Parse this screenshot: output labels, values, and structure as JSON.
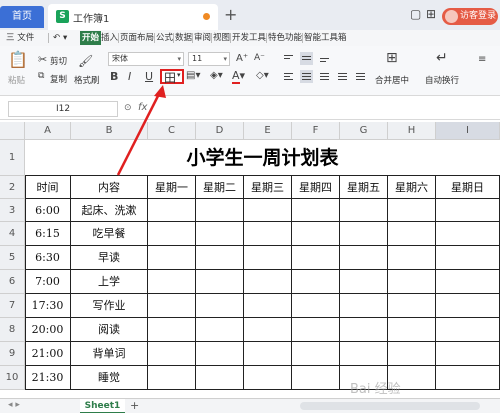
{
  "titlebar": {
    "home_tab": "首页",
    "doc_tab": "工作簿1",
    "doc_icon": "S",
    "add_tab": "+",
    "visitor_button": "访客登录"
  },
  "menu": {
    "file": "三 文件",
    "items": [
      "开始",
      "插入",
      "页面布局",
      "公式",
      "数据",
      "审阅",
      "视图",
      "开发工具",
      "特色功能",
      "智能工具箱"
    ]
  },
  "ribbon": {
    "paste": "粘贴",
    "cut": "剪切",
    "copy": "复制",
    "format_painter": "格式刷",
    "font_name": "宋体",
    "font_size": "11",
    "bold": "B",
    "italic": "I",
    "underline": "U",
    "border": "田",
    "font_color": "A",
    "merge_center": "合并居中",
    "wrap_text": "自动换行"
  },
  "formula": {
    "cell_ref": "I12",
    "fx": "fx"
  },
  "columns": [
    "A",
    "B",
    "C",
    "D",
    "E",
    "F",
    "G",
    "H",
    "I"
  ],
  "rows": [
    "1",
    "2",
    "3",
    "4",
    "5",
    "6",
    "7",
    "8",
    "9",
    "10"
  ],
  "sheet": {
    "title": "小学生一周计划表",
    "headers": [
      "时间",
      "内容",
      "星期一",
      "星期二",
      "星期三",
      "星期四",
      "星期五",
      "星期六",
      "星期日"
    ],
    "data": [
      [
        "6:00",
        "起床、洗漱"
      ],
      [
        "6:15",
        "吃早餐"
      ],
      [
        "6:30",
        "早读"
      ],
      [
        "7:00",
        "上学"
      ],
      [
        "17:30",
        "写作业"
      ],
      [
        "20:00",
        "阅读"
      ],
      [
        "21:00",
        "背单词"
      ],
      [
        "21:30",
        "睡觉"
      ]
    ]
  },
  "sheet_tab": "Sheet1",
  "watermark": "Bai 经验",
  "colors": {
    "accent": "#2e7d4a",
    "home_tab": "#3b6fd6",
    "highlight": "#e02020"
  }
}
